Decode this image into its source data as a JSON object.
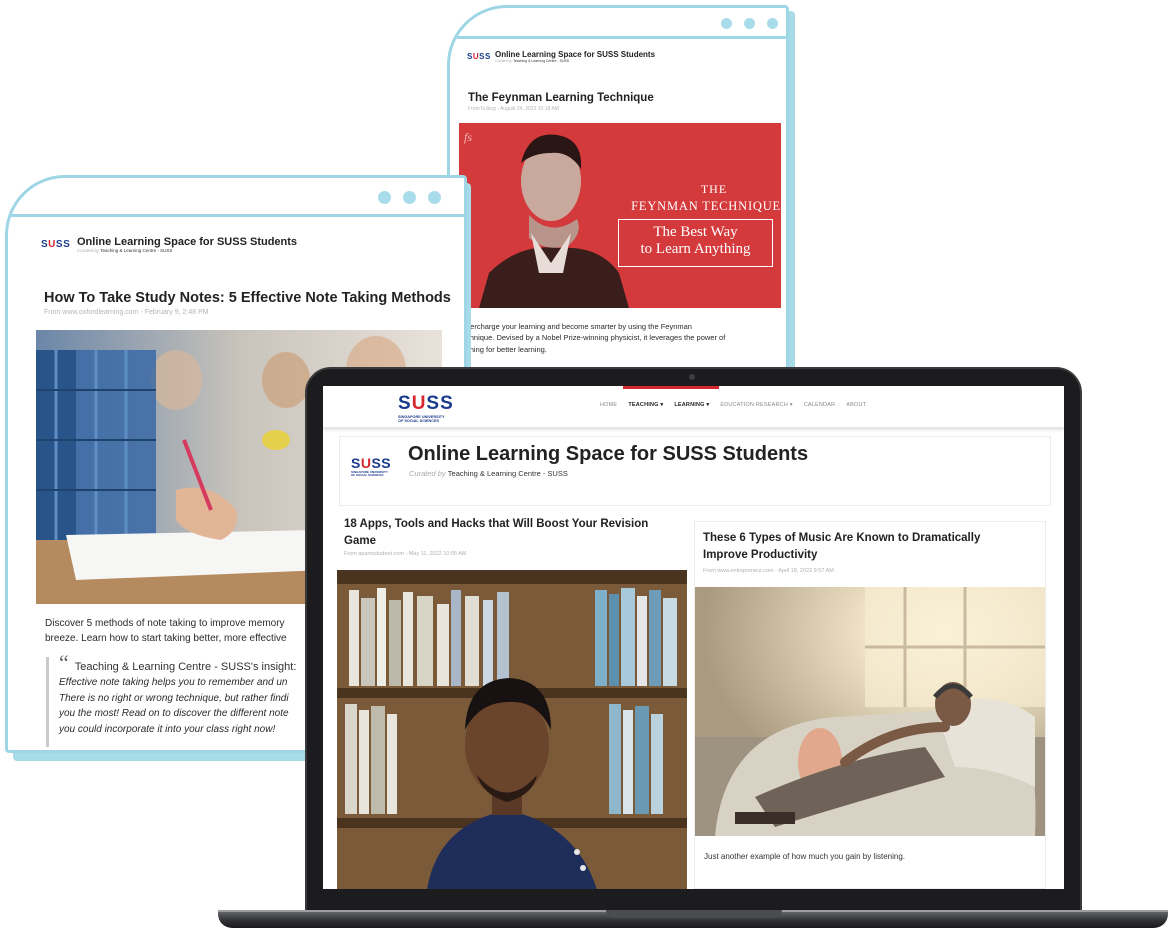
{
  "colors": {
    "card_border": "#9fd6e6",
    "brand_blue": "#1a3a8c",
    "brand_red": "#d6262e",
    "feynman_red": "#d43a3c"
  },
  "brand": {
    "logo": "SUSS",
    "logo_sub_1": "SINGAPORE UNIVERSITY",
    "logo_sub_2": "OF SOCIAL SCIENCES"
  },
  "site": {
    "title": "Online Learning Space for SUSS Students",
    "curated_prefix": "Curated by",
    "curator": "Teaching & Learning Centre - SUSS"
  },
  "card_feynman": {
    "title": "The Feynman Learning Technique",
    "meta": "From fs.blog - August 24, 2022 10:18 AM",
    "image": {
      "fs_mark": "fs",
      "line1": "THE",
      "line2": "FEYNMAN TECHNIQUE",
      "line3": "The Best Way",
      "line4": "to Learn Anything"
    },
    "body_1": "percharge your learning and become smarter by using the Feynman",
    "body_2": "chnique. Devised by a Nobel Prize-winning physicist, it leverages the power of",
    "body_3": "ching for better learning."
  },
  "card_notes": {
    "title": "How To Take Study Notes: 5 Effective Note Taking Methods",
    "meta": "From www.oxfordlearning.com - February 9, 2:48 PM",
    "body_1": "Discover 5 methods of note taking to improve memory",
    "body_2": "breeze. Learn how to start taking better, more effective",
    "insight_quote": "“",
    "insight_label": "Teaching & Learning Centre - SUSS's insight:",
    "insight_1": "Effective note taking helps you to remember and un",
    "insight_2": "There is no right or wrong technique, but rather findi",
    "insight_3": "you the most! Read on to discover the different note",
    "insight_4": "you could incorporate it into your class right now!"
  },
  "laptop": {
    "nav": {
      "items": [
        "HOME",
        "TEACHING ▾",
        "LEARNING ▾",
        "EDUCATION RESEARCH ▾",
        "CALENDAR",
        "ABOUT"
      ]
    },
    "post_left": {
      "title_1": "18 Apps, Tools and Hacks that Will Boost Your Revision",
      "title_2": "Game",
      "meta": "From apartostudent.com - May 11, 2022 10:05 AM"
    },
    "post_right": {
      "title_1": "These 6 Types of Music Are Known to Dramatically",
      "title_2": "Improve Productivity",
      "meta": "From www.entrepreneur.com - April 18, 2022 9:57 AM",
      "body": "Just another example of how much you gain by listening."
    }
  }
}
